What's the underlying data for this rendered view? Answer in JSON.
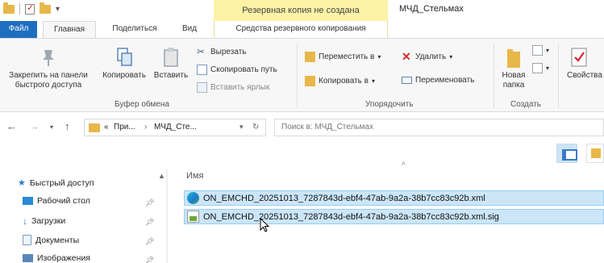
{
  "titlebar": {
    "context_header": "Резервная копия не создана",
    "window_title": "МЧД_Стельмах"
  },
  "tabs": {
    "file": "Файл",
    "home": "Главная",
    "share": "Поделиться",
    "view": "Вид",
    "backup_tools": "Средства резервного копирования"
  },
  "ribbon": {
    "clipboard": {
      "pin_quick_access": "Закрепить на панели быстрого доступа",
      "copy": "Копировать",
      "paste": "Вставить",
      "cut": "Вырезать",
      "copy_path": "Скопировать путь",
      "paste_shortcut": "Вставить ярлык",
      "group_label": "Буфер обмена"
    },
    "organize": {
      "move_to": "Переместить в",
      "copy_to": "Копировать в",
      "delete": "Удалить",
      "rename": "Переименовать",
      "group_label": "Упорядочить"
    },
    "new": {
      "new_folder_line1": "Новая",
      "new_folder_line2": "папка",
      "group_label": "Создать"
    },
    "open": {
      "properties": "Свойства"
    }
  },
  "address": {
    "prefix": "«",
    "crumb1": "При...",
    "crumb2": "МЧД_Сте...",
    "search_placeholder": "Поиск в: МЧД_Стельмах"
  },
  "navpane": {
    "quick_access": "Быстрый доступ",
    "items": [
      {
        "label": "Рабочий стол",
        "icon": "desktop-icon"
      },
      {
        "label": "Загрузки",
        "icon": "downloads-icon"
      },
      {
        "label": "Документы",
        "icon": "documents-icon"
      },
      {
        "label": "Изображения",
        "icon": "pictures-icon"
      }
    ]
  },
  "filelist": {
    "column_name": "Имя",
    "files": [
      {
        "name": "ON_EMCHD_20251013_7287843d-ebf4-47ab-9a2a-38b7cc83c92b.xml",
        "icon": "edge-xml-icon"
      },
      {
        "name": "ON_EMCHD_20251013_7287843d-ebf4-47ab-9a2a-38b7cc83c92b.xml.sig",
        "icon": "signature-file-icon"
      }
    ]
  },
  "colors": {
    "file_tab": "#1e6ec0",
    "context_header": "#fdf3a7",
    "selection": "#cce6f8",
    "folder": "#e8b74a"
  }
}
